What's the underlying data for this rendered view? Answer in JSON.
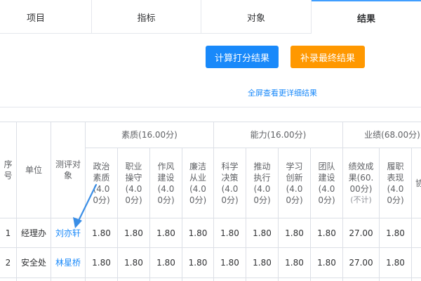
{
  "tabs": [
    {
      "label": "项目"
    },
    {
      "label": "指标"
    },
    {
      "label": "对象"
    },
    {
      "label": "结果",
      "active": true
    }
  ],
  "actions": {
    "calculate_label": "计算打分结果",
    "supplement_label": "补录最终结果",
    "fullscreen_label": "全屏查看更详细结果"
  },
  "table": {
    "headers": {
      "index": "序号",
      "unit": "单位",
      "target": "测评对象",
      "group_quality": "素质(16.00分)",
      "group_ability": "能力(16.00分)",
      "group_performance": "业绩(68.00分)",
      "cols": [
        "政治素质(4.00分)",
        "职业操守(4.00分)",
        "作风建设(4.00分)",
        "廉洁从业(4.00分)",
        "科学决策(4.00分)",
        "推动执行(4.00分)",
        "学习创新(4.00分)",
        "团队建设(4.00分)",
        "绩效成果(60.00分)",
        "履职表现(4.00分)",
        "协"
      ],
      "perf_note": "(不计)"
    },
    "rows": [
      {
        "index": "1",
        "unit": "经理办",
        "target": "刘亦轩",
        "scores": [
          "1.80",
          "1.80",
          "1.80",
          "1.80",
          "1.80",
          "1.80",
          "1.80",
          "1.80",
          "27.00",
          "1.80"
        ]
      },
      {
        "index": "2",
        "unit": "安全处",
        "target": "林星桥",
        "scores": [
          "1.80",
          "1.80",
          "1.80",
          "1.80",
          "1.80",
          "1.80",
          "1.80",
          "1.80",
          "27.00",
          "1.80"
        ]
      }
    ]
  },
  "colors": {
    "accent": "#1989fa",
    "warning": "#ff9800",
    "border": "#dcdfe6"
  }
}
